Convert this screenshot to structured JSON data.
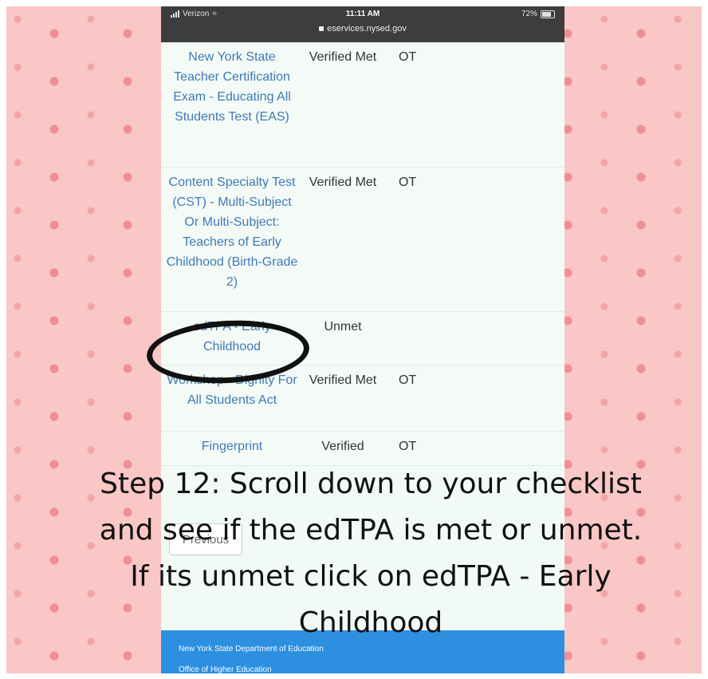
{
  "statusbar": {
    "carrier": "Verizon",
    "time": "11:11 AM",
    "battery": "72%",
    "url": "eservices.nysed.gov"
  },
  "checklist": [
    {
      "requirement": "New York State Teacher Certification Exam - Educating All Students Test (EAS)",
      "status": "Verified Met",
      "source": "OT"
    },
    {
      "requirement": "Content Specialty Test (CST) - Multi-Subject Or Multi-Subject: Teachers of Early Childhood (Birth-Grade 2)",
      "status": "Verified Met",
      "source": "OT"
    },
    {
      "requirement": "edTPA - Early Childhood",
      "status": "Unmet",
      "source": ""
    },
    {
      "requirement": "Workshop - Dignity For All Students Act",
      "status": "Verified Met",
      "source": "OT"
    },
    {
      "requirement": "Fingerprint",
      "status": "Verified",
      "source": "OT"
    }
  ],
  "buttons": {
    "previous": "Previous"
  },
  "footer": {
    "line1": "New York State Department of Education",
    "line2": "Office of Higher Education"
  },
  "caption": "Step 12: Scroll down to your checklist and see if the edTPA is met or unmet. If its unmet click on edTPA - Early Childhood"
}
